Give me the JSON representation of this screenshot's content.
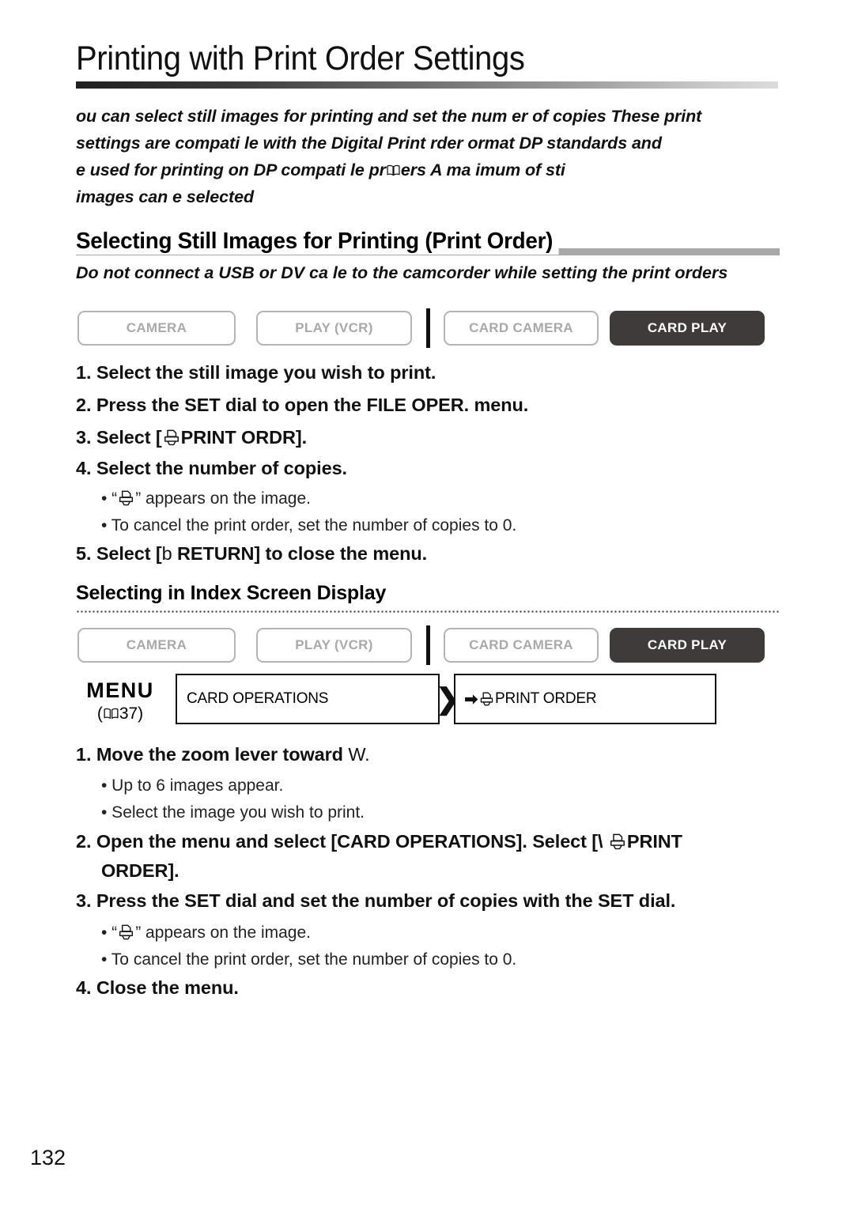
{
  "document": {
    "title": "Printing with Print Order Settings",
    "page_number": "132"
  },
  "intro": {
    "line1": "ou can select still images for printing and set the num  er of copies  These print",
    "line2": "settings are compati  le with the Digital Print   rder   ormat  DP      standards and",
    "line3": " e used for printing on DP      compati  le pr",
    "line3b": "ers                  A ma  imum of        sti",
    "line4": "images can   e selected"
  },
  "section": {
    "heading": "Selecting Still Images for Printing (Print Order)",
    "warning": "Do not connect a USB or DV ca  le to the camcorder while setting the print orders"
  },
  "modes": {
    "items": [
      {
        "label": "CAMERA",
        "active": false
      },
      {
        "label": "PLAY (VCR)",
        "active": false
      },
      {
        "label": "CARD CAMERA",
        "active": false
      },
      {
        "label": "CARD PLAY",
        "active": true
      }
    ]
  },
  "steps_part1": [
    {
      "text": "1. Select the still image you wish to print."
    },
    {
      "text": "2. Press the SET dial to open the FILE OPER. menu."
    },
    {
      "prefix": "3. Select [",
      "icon": "printer-icon",
      "suffix": "PRINT ORDR]."
    },
    {
      "text": "4. Select the number of copies."
    }
  ],
  "bullets_part1": [
    {
      "prefix": "• “",
      "icon": "printer-icon",
      "suffix": "” appears on the image."
    },
    {
      "text": "• To cancel the print order, set the number of copies to 0."
    }
  ],
  "step5": {
    "prefix": "5. Select [",
    "lite": "b",
    "suffix": " RETURN] to close the menu."
  },
  "subsection": {
    "heading": "Selecting in Index Screen Display"
  },
  "menu_nav": {
    "menu_word": "MENU",
    "page_ref_prefix": "(",
    "page_ref_icon": "book-icon",
    "page_ref_number": "37",
    "page_ref_suffix": ")",
    "box1_label": "CARD OPERATIONS",
    "chevron_icon": "double-chevron-right-icon",
    "box2_arrow_icon": "arrow-right-icon",
    "box2_printer_icon": "printer-icon",
    "box2_label": "PRINT ORDER"
  },
  "steps_part2": [
    {
      "prefix": "1. Move the zoom lever toward ",
      "lite": "W."
    },
    {
      "prefix": "2. Open the menu and select [CARD OPERATIONS]. Select [\\ ",
      "icon": "printer-icon",
      "suffix": "PRINT"
    },
    {
      "text": "ORDER]."
    },
    {
      "text": "3. Press the SET dial and set the number of copies with the SET dial."
    },
    {
      "text": "4. Close the menu."
    }
  ],
  "bullets_part2": [
    {
      "prefix": "• “",
      "icon": "printer-icon",
      "suffix": "” appears on the image."
    },
    {
      "text": "• To cancel the print order, set the number of copies to 0."
    }
  ],
  "bullets_part2b": [
    {
      "text": "• Up to 6 images appear."
    },
    {
      "text": "• Select the image you wish to print."
    }
  ],
  "colors": {
    "active_mode_bg": "#3f3b3a",
    "inactive_mode_border": "#b4b4b4",
    "inactive_mode_text": "#a9a9a9",
    "section_bar": "#a8a8a8",
    "ink": "#111111"
  }
}
